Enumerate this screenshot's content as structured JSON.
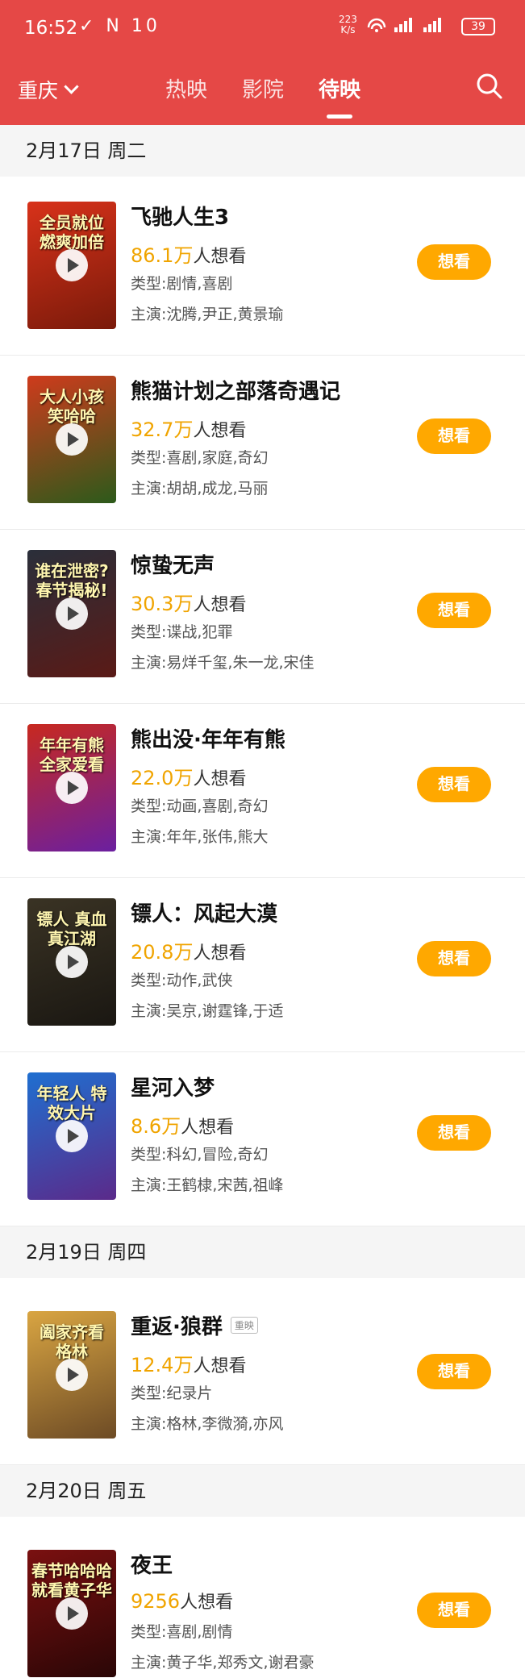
{
  "status_bar": {
    "time": "16:52",
    "left_icons": "✓ N 10",
    "net_speed": "223\nK/s",
    "right_icons": "☰ ▐▐ ▐▐",
    "battery": "39"
  },
  "header": {
    "city": "重庆",
    "tabs": [
      "热映",
      "影院",
      "待映"
    ],
    "active_tab": "待映",
    "accent_color": "#e54846"
  },
  "want_button_label": "想看",
  "want_suffix": "人想看",
  "dates": [
    {
      "label": "2月17日 周二",
      "movies": [
        {
          "title": "飞驰人生3",
          "want_count": "86.1万",
          "genre": "类型:剧情,喜剧",
          "cast": "主演:沈腾,尹正,黄景瑜",
          "poster_text": "全员就位 燃爽加倍",
          "poster_colors": [
            "#d8321a",
            "#7a1a0a"
          ]
        },
        {
          "title": "熊猫计划之部落奇遇记",
          "want_count": "32.7万",
          "genre": "类型:喜剧,家庭,奇幻",
          "cast": "主演:胡胡,成龙,马丽",
          "poster_text": "大人小孩 笑哈哈",
          "poster_colors": [
            "#cf3b1c",
            "#2c5a1b"
          ]
        },
        {
          "title": "惊蛰无声",
          "want_count": "30.3万",
          "genre": "类型:谍战,犯罪",
          "cast": "主演:易烊千玺,朱一龙,宋佳",
          "poster_text": "谁在泄密? 春节揭秘!",
          "poster_colors": [
            "#2a2f3a",
            "#5a1a16"
          ]
        },
        {
          "title": "熊出没·年年有熊",
          "want_count": "22.0万",
          "genre": "类型:动画,喜剧,奇幻",
          "cast": "主演:年年,张伟,熊大",
          "poster_text": "年年有熊 全家爱看",
          "poster_colors": [
            "#c8291f",
            "#6b1fa0"
          ]
        },
        {
          "title": "镖人：风起大漠",
          "want_count": "20.8万",
          "genre": "类型:动作,武侠",
          "cast": "主演:吴京,谢霆锋,于适",
          "poster_text": "镖人 真血 真江湖",
          "poster_colors": [
            "#3a3324",
            "#1a1712"
          ]
        },
        {
          "title": "星河入梦",
          "want_count": "8.6万",
          "genre": "类型:科幻,冒险,奇幻",
          "cast": "主演:王鹤棣,宋茜,祖峰",
          "poster_text": "年轻人 特效大片",
          "poster_colors": [
            "#1f6fd0",
            "#5b2a8a"
          ]
        }
      ]
    },
    {
      "label": "2月19日 周四",
      "movies": [
        {
          "title": "重返·狼群",
          "tag": "重映",
          "want_count": "12.4万",
          "genre": "类型:纪录片",
          "cast": "主演:格林,李微漪,亦风",
          "poster_text": "阖家齐看 格林",
          "poster_colors": [
            "#d9a542",
            "#6d4b25"
          ]
        }
      ]
    },
    {
      "label": "2月20日 周五",
      "movies": [
        {
          "title": "夜王",
          "want_count": "9256",
          "genre": "类型:喜剧,剧情",
          "cast": "主演:黄子华,郑秀文,谢君豪",
          "poster_text": "春节哈哈哈 就看黄子华",
          "poster_colors": [
            "#7a1010",
            "#2a0606"
          ]
        }
      ]
    }
  ]
}
